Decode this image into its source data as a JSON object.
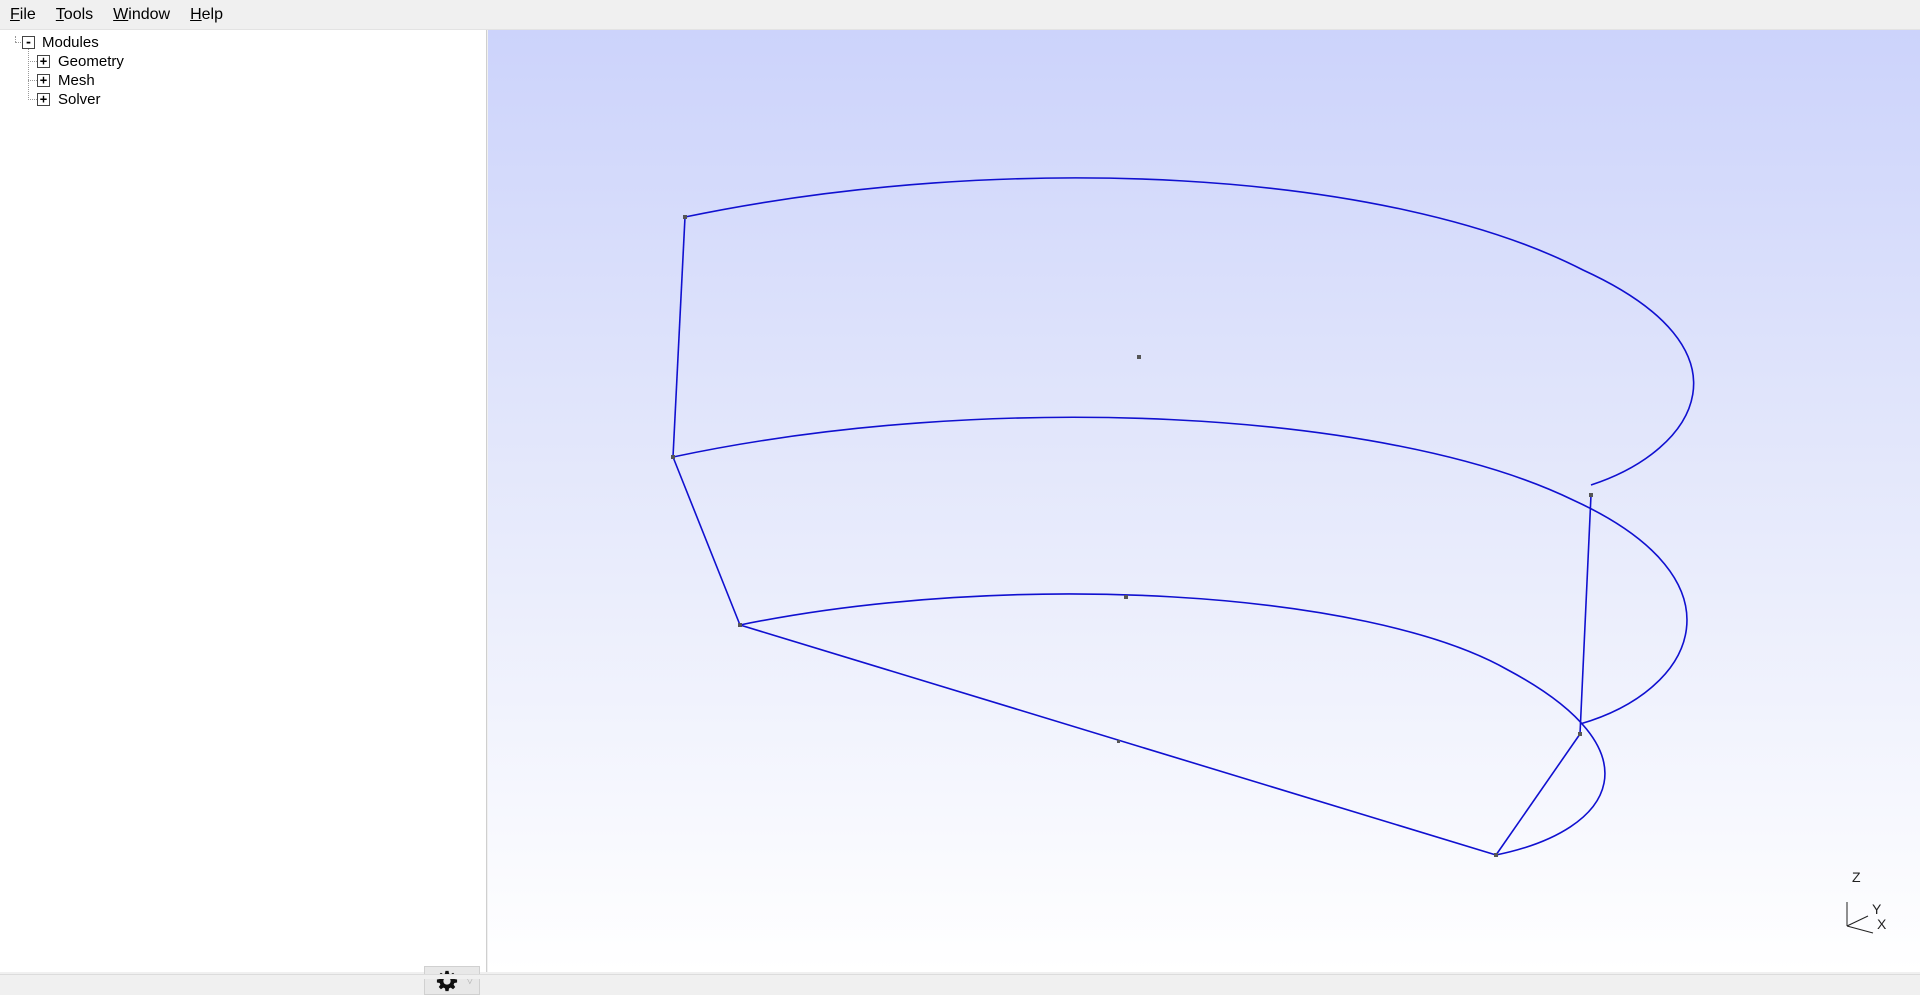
{
  "menubar": {
    "items": [
      {
        "label": "File",
        "mnemonic": "F",
        "rest": "ile"
      },
      {
        "label": "Tools",
        "mnemonic": "T",
        "rest": "ools"
      },
      {
        "label": "Window",
        "mnemonic": "W",
        "rest": "indow"
      },
      {
        "label": "Help",
        "mnemonic": "H",
        "rest": "elp"
      }
    ]
  },
  "tree": {
    "root": {
      "label": "Modules",
      "state": "-"
    },
    "children": [
      {
        "label": "Geometry",
        "state": "+"
      },
      {
        "label": "Mesh",
        "state": "+"
      },
      {
        "label": "Solver",
        "state": "+"
      }
    ]
  },
  "viewport": {
    "axes": {
      "z": "Z",
      "y": "Y",
      "x": "X"
    },
    "line_color": "#1010d0",
    "point_color": "#555555"
  },
  "settings": {
    "icon": "gear-icon",
    "dropdown_icon": "triangle-down-icon"
  }
}
